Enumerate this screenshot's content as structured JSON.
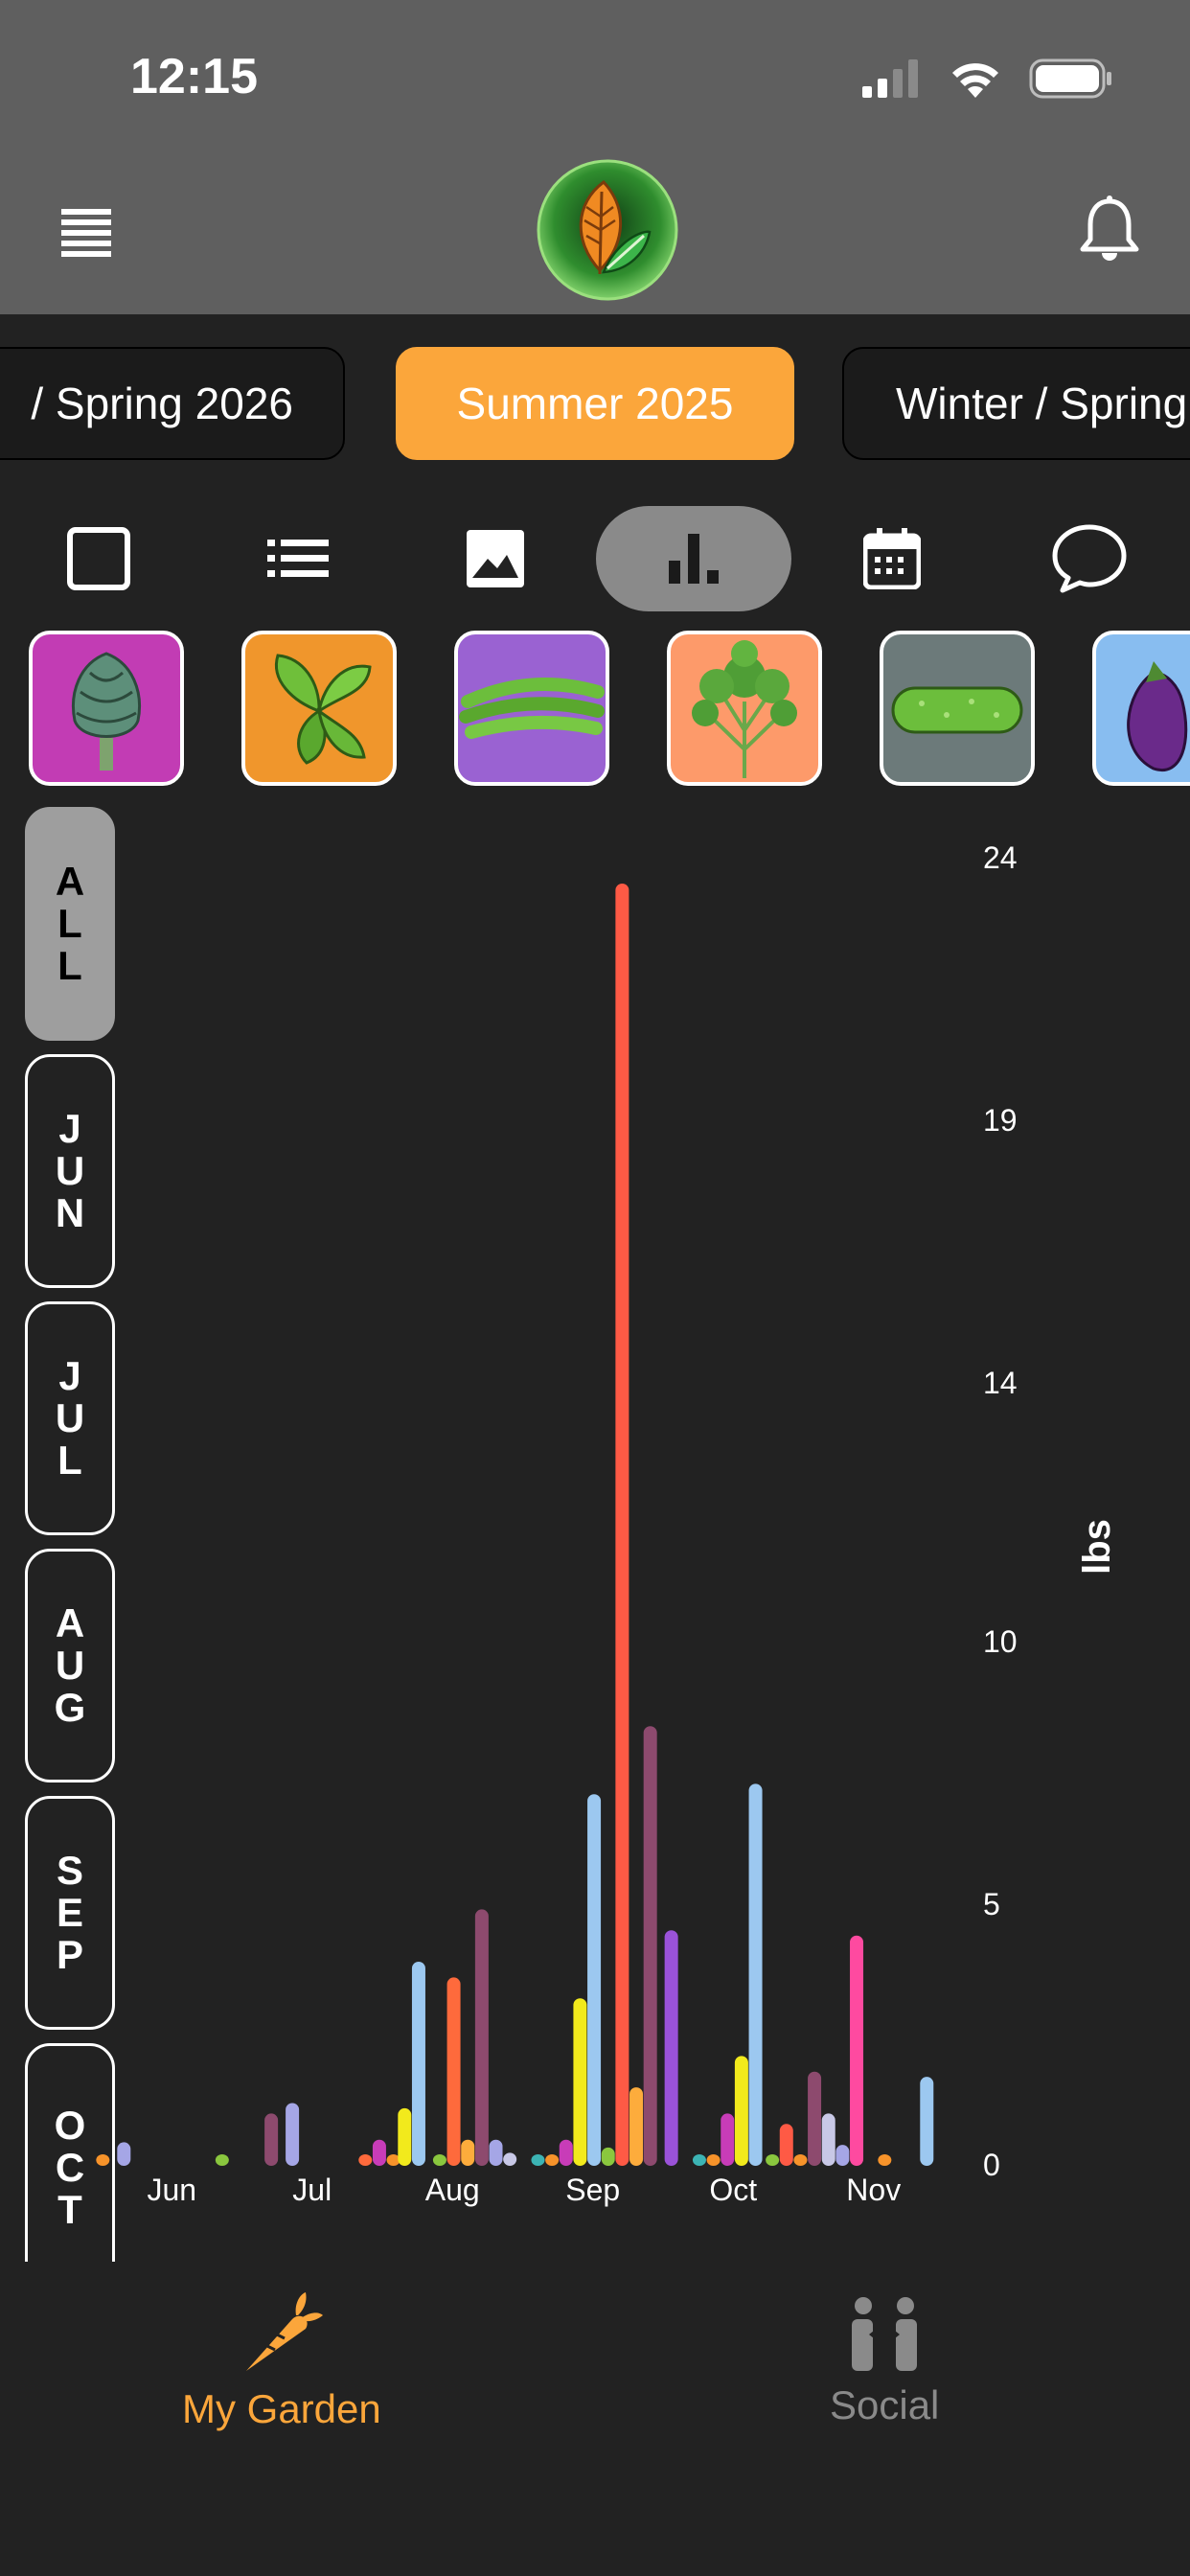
{
  "status_bar": {
    "time": "12:15"
  },
  "seasons": [
    {
      "label": "/ Spring 2026",
      "active": false
    },
    {
      "label": "Summer 2025",
      "active": true
    },
    {
      "label": "Winter / Spring",
      "active": false
    }
  ],
  "view_modes": [
    {
      "icon": "square-icon",
      "active": false
    },
    {
      "icon": "list-icon",
      "active": false
    },
    {
      "icon": "image-icon",
      "active": false
    },
    {
      "icon": "bar-chart-icon",
      "active": true
    },
    {
      "icon": "calendar-icon",
      "active": false
    },
    {
      "icon": "chat-bubble-icon",
      "active": false
    }
  ],
  "crops": [
    {
      "name": "artichoke",
      "bg": "#c23cb4"
    },
    {
      "name": "basil",
      "bg": "#f0962c"
    },
    {
      "name": "green-beans",
      "bg": "#9a62d2"
    },
    {
      "name": "cilantro",
      "bg": "#fd9a6a"
    },
    {
      "name": "cucumber",
      "bg": "#6c7a7a"
    },
    {
      "name": "eggplant",
      "bg": "#88bdf0"
    }
  ],
  "month_filter": [
    {
      "label": "ALL",
      "active": true
    },
    {
      "label": "JUN",
      "active": false
    },
    {
      "label": "JUL",
      "active": false
    },
    {
      "label": "AUG",
      "active": false
    },
    {
      "label": "SEP",
      "active": false
    },
    {
      "label": "OCT",
      "active": false
    }
  ],
  "chart_data": {
    "type": "bar",
    "ylabel": "lbs",
    "y_ticks": [
      0,
      5,
      10,
      14,
      19,
      24
    ],
    "ylim": [
      0,
      24.5
    ],
    "x_ticks": [
      "Jun",
      "Jul",
      "Aug",
      "Sep",
      "Oct",
      "Nov"
    ],
    "colors": {
      "orange": "#f7932a",
      "lavender": "#a5a6e6",
      "green": "#8ac73e",
      "plum": "#8d4a6e",
      "magenta": "#c83cb8",
      "yellow": "#f2ea1c",
      "skyblue": "#9cc8f0",
      "red": "#fe5a45",
      "coral": "#fe6a3c",
      "amber": "#fdac3c",
      "purple": "#9a52d8",
      "pink": "#fe4aa0",
      "teal": "#3cb4b4",
      "gray": "#c8c8e6"
    },
    "bars": [
      {
        "x": 0.05,
        "value": 0.1,
        "color": "orange"
      },
      {
        "x": 0.2,
        "value": 0.45,
        "color": "lavender"
      },
      {
        "x": 0.9,
        "value": 0.1,
        "color": "green"
      },
      {
        "x": 1.25,
        "value": 1.0,
        "color": "plum"
      },
      {
        "x": 1.4,
        "value": 1.2,
        "color": "lavender"
      },
      {
        "x": 1.92,
        "value": 0.1,
        "color": "coral"
      },
      {
        "x": 2.02,
        "value": 0.5,
        "color": "magenta"
      },
      {
        "x": 2.12,
        "value": 0.15,
        "color": "orange"
      },
      {
        "x": 2.2,
        "value": 1.1,
        "color": "yellow"
      },
      {
        "x": 2.3,
        "value": 3.9,
        "color": "skyblue"
      },
      {
        "x": 2.45,
        "value": 0.1,
        "color": "green"
      },
      {
        "x": 2.55,
        "value": 3.6,
        "color": "coral"
      },
      {
        "x": 2.65,
        "value": 0.5,
        "color": "amber"
      },
      {
        "x": 2.75,
        "value": 4.9,
        "color": "plum"
      },
      {
        "x": 2.85,
        "value": 0.5,
        "color": "lavender"
      },
      {
        "x": 2.95,
        "value": 0.25,
        "color": "gray"
      },
      {
        "x": 3.15,
        "value": 0.1,
        "color": "teal"
      },
      {
        "x": 3.25,
        "value": 0.15,
        "color": "orange"
      },
      {
        "x": 3.35,
        "value": 0.5,
        "color": "magenta"
      },
      {
        "x": 3.45,
        "value": 3.2,
        "color": "yellow"
      },
      {
        "x": 3.55,
        "value": 7.1,
        "color": "skyblue"
      },
      {
        "x": 3.65,
        "value": 0.35,
        "color": "green"
      },
      {
        "x": 3.75,
        "value": 24.5,
        "color": "red"
      },
      {
        "x": 3.85,
        "value": 1.5,
        "color": "amber"
      },
      {
        "x": 3.95,
        "value": 8.4,
        "color": "plum"
      },
      {
        "x": 4.1,
        "value": 4.5,
        "color": "purple"
      },
      {
        "x": 4.3,
        "value": 0.1,
        "color": "teal"
      },
      {
        "x": 4.4,
        "value": 0.15,
        "color": "orange"
      },
      {
        "x": 4.5,
        "value": 1.0,
        "color": "magenta"
      },
      {
        "x": 4.6,
        "value": 2.1,
        "color": "yellow"
      },
      {
        "x": 4.7,
        "value": 7.3,
        "color": "skyblue"
      },
      {
        "x": 4.82,
        "value": 0.1,
        "color": "green"
      },
      {
        "x": 4.92,
        "value": 0.8,
        "color": "red"
      },
      {
        "x": 5.02,
        "value": 0.15,
        "color": "orange"
      },
      {
        "x": 5.12,
        "value": 1.8,
        "color": "plum"
      },
      {
        "x": 5.22,
        "value": 1.0,
        "color": "gray"
      },
      {
        "x": 5.32,
        "value": 0.4,
        "color": "lavender"
      },
      {
        "x": 5.42,
        "value": 4.4,
        "color": "pink"
      },
      {
        "x": 5.62,
        "value": 0.1,
        "color": "orange"
      },
      {
        "x": 5.92,
        "value": 1.7,
        "color": "skyblue"
      }
    ]
  },
  "tabs": [
    {
      "label": "My Garden",
      "active": true,
      "icon": "carrot-icon"
    },
    {
      "label": "Social",
      "active": false,
      "icon": "people-icon"
    }
  ]
}
